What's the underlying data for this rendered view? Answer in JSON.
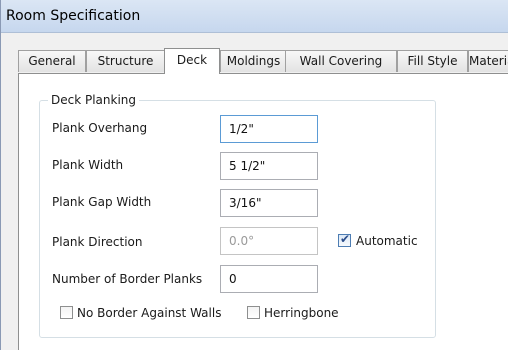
{
  "window": {
    "title": "Room Specification"
  },
  "tabs": [
    {
      "label": "General",
      "active": false
    },
    {
      "label": "Structure",
      "active": false
    },
    {
      "label": "Deck",
      "active": true
    },
    {
      "label": "Moldings",
      "active": false
    },
    {
      "label": "Wall Covering",
      "active": false
    },
    {
      "label": "Fill Style",
      "active": false
    },
    {
      "label": "Materials",
      "active": false
    }
  ],
  "deck_planking": {
    "legend": "Deck Planking",
    "plank_overhang": {
      "label": "Plank Overhang",
      "value": "1/2\""
    },
    "plank_width": {
      "label": "Plank Width",
      "value": "5 1/2\""
    },
    "plank_gap_width": {
      "label": "Plank Gap Width",
      "value": "3/16\""
    },
    "plank_direction": {
      "label": "Plank Direction",
      "value": "0.0°",
      "enabled": false
    },
    "automatic": {
      "label": "Automatic",
      "checked": true
    },
    "border_planks": {
      "label": "Number of Border Planks",
      "value": "0"
    },
    "no_border_against_walls": {
      "label": "No Border Against Walls",
      "checked": false
    },
    "herringbone": {
      "label": "Herringbone",
      "checked": false
    }
  }
}
